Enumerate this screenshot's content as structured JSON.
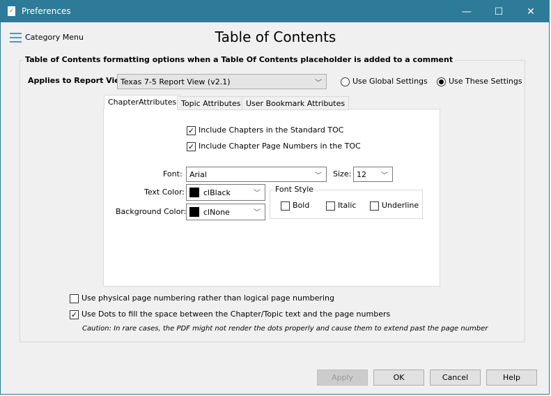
{
  "window": {
    "title": "Preferences",
    "minimize": "—",
    "maximize": "☐",
    "close": "✕"
  },
  "category_menu": "Category Menu",
  "page_title": "Table of Contents",
  "group_legend": "Table of Contents formatting options when a Table Of Contents placeholder is added to a comment",
  "report_view": {
    "label": "Applies to Report View:",
    "value": "Texas 7-5 Report View (v2.1)"
  },
  "settings": {
    "global": "Use Global Settings",
    "these": "Use These Settings",
    "selected": "these"
  },
  "tabs": [
    {
      "label": "ChapterAttributes",
      "active": true
    },
    {
      "label": "Topic Attributes"
    },
    {
      "label": "User Bookmark Attributes"
    }
  ],
  "chapter": {
    "include_chapters": {
      "label": "Include Chapters in the Standard TOC",
      "checked": true
    },
    "include_page_numbers": {
      "label": "Include Chapter Page Numbers in the TOC",
      "checked": true
    },
    "font_label": "Font:",
    "font_value": "Arial",
    "size_label": "Size:",
    "size_value": "12",
    "text_color_label": "Text Color:",
    "text_color_value": "clBlack",
    "text_color_swatch": "#000000",
    "bg_color_label": "Background Color:",
    "bg_color_value": "clNone",
    "bg_color_swatch": "#000000",
    "font_style": {
      "legend": "Font Style",
      "bold": "Bold",
      "italic": "Italic",
      "underline": "Underline"
    }
  },
  "physical_numbering": {
    "label": "Use physical page numbering rather than logical page numbering",
    "checked": false
  },
  "use_dots": {
    "label": "Use Dots to fill the space between the Chapter/Topic text and the page numbers",
    "checked": true
  },
  "caution": "Caution: In rare cases, the PDF might not render the dots properly and cause them to extend past the page number",
  "buttons": {
    "apply": "Apply",
    "ok": "OK",
    "cancel": "Cancel",
    "help": "Help"
  },
  "colors": {
    "titlebar": "#2e7a99"
  }
}
